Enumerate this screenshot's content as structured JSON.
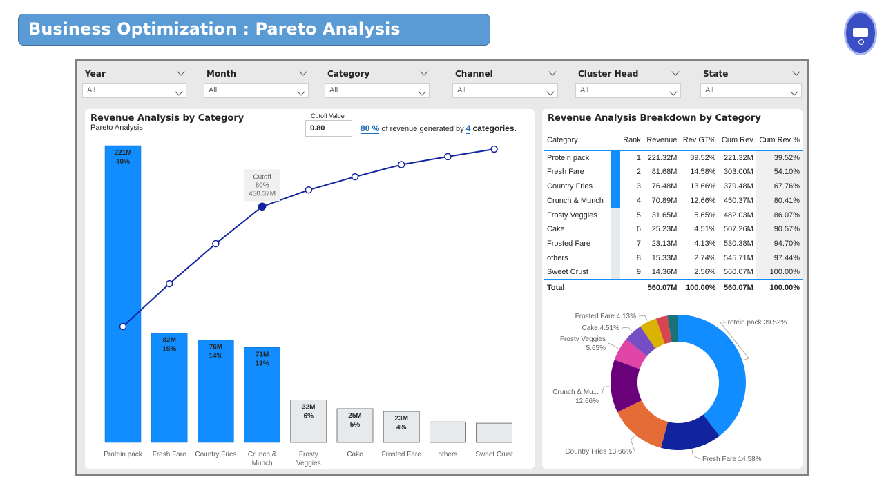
{
  "header": {
    "title": "Business Optimization : Pareto Analysis"
  },
  "slicers": [
    {
      "label": "Year",
      "value": "All"
    },
    {
      "label": "Month",
      "value": "All"
    },
    {
      "label": "Category",
      "value": "All"
    },
    {
      "label": "Channel",
      "value": "All"
    },
    {
      "label": "Cluster Head",
      "value": "All"
    },
    {
      "label": "State",
      "value": "All"
    }
  ],
  "pareto_panel": {
    "title": "Revenue Analysis by Category",
    "subtitle": "Pareto Analysis",
    "cutoff_label": "Cutoff Value",
    "cutoff_value": "0.80",
    "summary_pct": "80 %",
    "summary_text": "of revenue generated by",
    "summary_count": "4",
    "summary_suffix": "categories.",
    "tooltip": {
      "line1": "Cutoff",
      "line2": "80%",
      "line3": "450.37M"
    }
  },
  "breakdown_panel": {
    "title": "Revenue Analysis Breakdown by Category",
    "columns": [
      "Category",
      "Rank",
      "Revenue",
      "Rev GT%",
      "Cum Rev",
      "Cum Rev %"
    ],
    "rows": [
      [
        "Protein pack",
        "1",
        "221.32M",
        "39.52%",
        "221.32M",
        "39.52%"
      ],
      [
        "Fresh Fare",
        "2",
        "81.68M",
        "14.58%",
        "303.00M",
        "54.10%"
      ],
      [
        "Country Fries",
        "3",
        "76.48M",
        "13.66%",
        "379.48M",
        "67.76%"
      ],
      [
        "Crunch & Munch",
        "4",
        "70.89M",
        "12.66%",
        "450.37M",
        "80.41%"
      ],
      [
        "Frosty Veggies",
        "5",
        "31.65M",
        "5.65%",
        "482.03M",
        "86.07%"
      ],
      [
        "Cake",
        "6",
        "25.23M",
        "4.51%",
        "507.26M",
        "90.57%"
      ],
      [
        "Frosted Fare",
        "7",
        "23.13M",
        "4.13%",
        "530.38M",
        "94.70%"
      ],
      [
        "others",
        "8",
        "15.33M",
        "2.74%",
        "545.71M",
        "97.44%"
      ],
      [
        "Sweet Crust",
        "9",
        "14.36M",
        "2.56%",
        "560.07M",
        "100.00%"
      ]
    ],
    "total": [
      "Total",
      "",
      "560.07M",
      "100.00%",
      "560.07M",
      "100.00%"
    ]
  },
  "chart_data": [
    {
      "type": "bar",
      "categories": [
        "Protein pack",
        "Fresh Fare",
        "Country Fries",
        "Crunch & Munch",
        "Frosty Veggies",
        "Cake",
        "Frosted Fare",
        "others",
        "Sweet Crust"
      ],
      "series": [
        {
          "values": [
            221.32,
            81.68,
            76.48,
            70.89,
            31.65,
            25.23,
            23.13,
            15.33,
            14.36
          ]
        },
        {
          "values": [
            39.52,
            54.1,
            67.76,
            80.41,
            86.07,
            90.57,
            94.7,
            97.44,
            100.0
          ]
        }
      ],
      "data_labels": [
        [
          "221M",
          "40%"
        ],
        [
          "82M",
          "15%"
        ],
        [
          "76M",
          "14%"
        ],
        [
          "71M",
          "13%"
        ],
        [
          "32M",
          "6%"
        ],
        [
          "25M",
          "5%"
        ],
        [
          "23M",
          "4%"
        ],
        [
          "",
          ""
        ],
        [
          "",
          ""
        ]
      ],
      "highlight_count": 4,
      "colors": {
        "highlight": "#118dff",
        "other": "#e6eaed",
        "line": "#12239e"
      }
    },
    {
      "type": "pie",
      "labels": [
        "Protein pack",
        "Fresh Fare",
        "Country Fries",
        "Crunch & Munch",
        "Frosty Veggies",
        "Cake",
        "Frosted Fare",
        "others",
        "Sweet Crust"
      ],
      "values": [
        39.52,
        14.58,
        13.66,
        12.66,
        5.65,
        4.51,
        4.13,
        2.74,
        2.56
      ],
      "slice_labels": [
        "Protein pack 39.52%",
        "Fresh Fare 14.58%",
        "Country Fries 13.66%",
        "Crunch & Mu... 12.66%",
        "Frosty Veggies 5.65%",
        "Cake 4.51%",
        "Frosted Fare 4.13%",
        "",
        ""
      ],
      "colors": [
        "#118dff",
        "#12239e",
        "#e66c37",
        "#6b007b",
        "#e044a7",
        "#744ec2",
        "#d9b300",
        "#d64550",
        "#197278"
      ]
    }
  ]
}
